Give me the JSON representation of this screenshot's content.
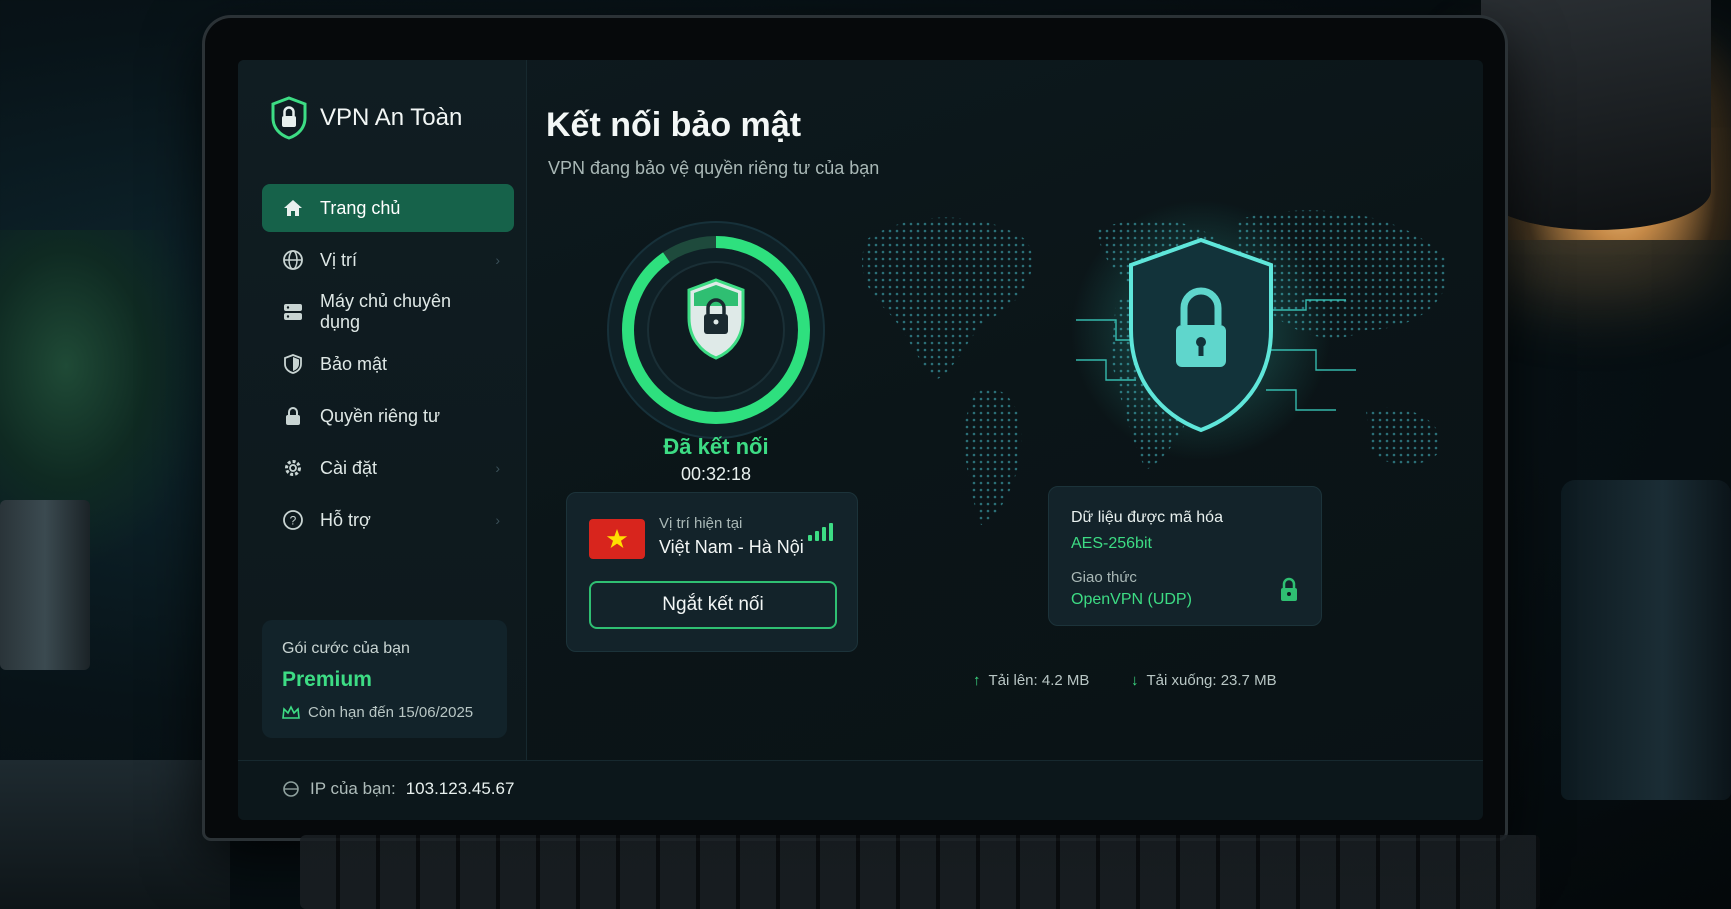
{
  "app": {
    "title": "VPN An Toàn"
  },
  "sidebar": {
    "items": [
      {
        "label": "Trang chủ",
        "icon": "home-icon",
        "active": true
      },
      {
        "label": "Vị trí",
        "icon": "globe-icon"
      },
      {
        "label": "Máy chủ chuyên dụng",
        "icon": "server-icon"
      },
      {
        "label": "Bảo mật",
        "icon": "shield-icon"
      },
      {
        "label": "Quyền riêng tư",
        "icon": "lock-icon"
      },
      {
        "label": "Cài đặt",
        "icon": "gear-icon"
      },
      {
        "label": "Hỗ trợ",
        "icon": "help-icon"
      }
    ],
    "plan": {
      "label": "Gói cước của bạn",
      "name": "Premium",
      "expiry": "Còn hạn đến 15/06/2025"
    }
  },
  "main": {
    "title": "Kết nối bảo mật",
    "subtitle": "VPN đang bảo vệ quyền riêng tư của bạn",
    "status": "Đã kết nối",
    "timer": "00:32:18",
    "location": {
      "label": "Vị trí hiện tại",
      "value": "Việt Nam - Hà Nội",
      "signal_level": 4
    },
    "disconnect_label": "Ngắt kết nối",
    "encryption": {
      "label": "Dữ liệu được mã hóa",
      "value": "AES-256bit",
      "protocol_label": "Giao thức",
      "protocol_value": "OpenVPN (UDP)"
    }
  },
  "footer": {
    "ip_label": "IP của bạn:",
    "ip_value": "103.123.45.67",
    "upload": "Tải lên: 4.2 MB",
    "download": "Tải xuống: 23.7 MB"
  },
  "colors": {
    "accent": "#3ddc84",
    "active_nav": "#16624a",
    "background": "#0e1a1f"
  }
}
